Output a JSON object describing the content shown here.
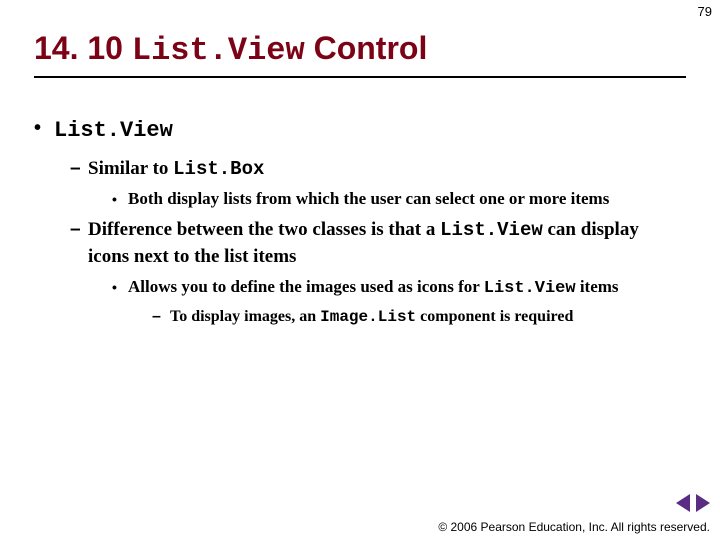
{
  "page_number": "79",
  "title": {
    "section_number": "14. 10",
    "code_part": "List.View",
    "suffix": "Control"
  },
  "bullets": {
    "lvl1_text": "List.View",
    "lvl2a_prefix": "Similar to ",
    "lvl2a_code": "List.Box",
    "lvl3a": "Both display lists from which the user can select one or more items",
    "lvl2b_prefix": "Difference between the two classes is that a ",
    "lvl2b_code": "List.View",
    "lvl2b_suffix": " can display icons next to the list items",
    "lvl3b_prefix": "Allows you to define the images used as icons for ",
    "lvl3b_code": "List.View",
    "lvl3b_suffix": " items",
    "lvl4_prefix": "To display images, an ",
    "lvl4_code": "Image.List",
    "lvl4_suffix": " component is required"
  },
  "footer": {
    "copyright_symbol": "©",
    "text": " 2006 Pearson Education, Inc.  All rights reserved."
  },
  "glyphs": {
    "disc": "•",
    "dash": "–"
  }
}
